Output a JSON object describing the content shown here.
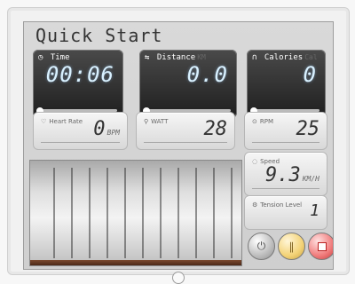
{
  "title": "Quick Start",
  "displays": [
    {
      "label": "Time",
      "value": "00:06",
      "icon": "clock-icon"
    },
    {
      "label": "Distance",
      "unit": "KM",
      "value": "0.0",
      "icon": "distance-icon"
    },
    {
      "label": "Calories",
      "unit": "Cal",
      "value": "0",
      "icon": "calorie-icon"
    }
  ],
  "metrics": [
    {
      "label": "Heart Rate",
      "value": "0",
      "unit": "BPM",
      "icon": "heart-icon"
    },
    {
      "label": "WATT",
      "value": "28",
      "icon": "watt-icon"
    },
    {
      "label": "RPM",
      "value": "25",
      "icon": "rpm-icon"
    },
    {
      "label": "Speed",
      "value": "9.3",
      "unit": "KM/H",
      "icon": "speed-icon"
    },
    {
      "label": "Tension Level",
      "value": "1",
      "icon": "tension-icon"
    }
  ],
  "buttons": [
    {
      "name": "gray-control",
      "icon": "power-icon"
    },
    {
      "name": "gold-control",
      "icon": "pause-icon"
    },
    {
      "name": "red-control",
      "icon": "stop-icon"
    }
  ],
  "colors": {
    "panel_dark": "#2d2d2d",
    "screen_bg": "#d7d7d7",
    "accent_gold": "#f3d276",
    "accent_red": "#e45c5c"
  }
}
